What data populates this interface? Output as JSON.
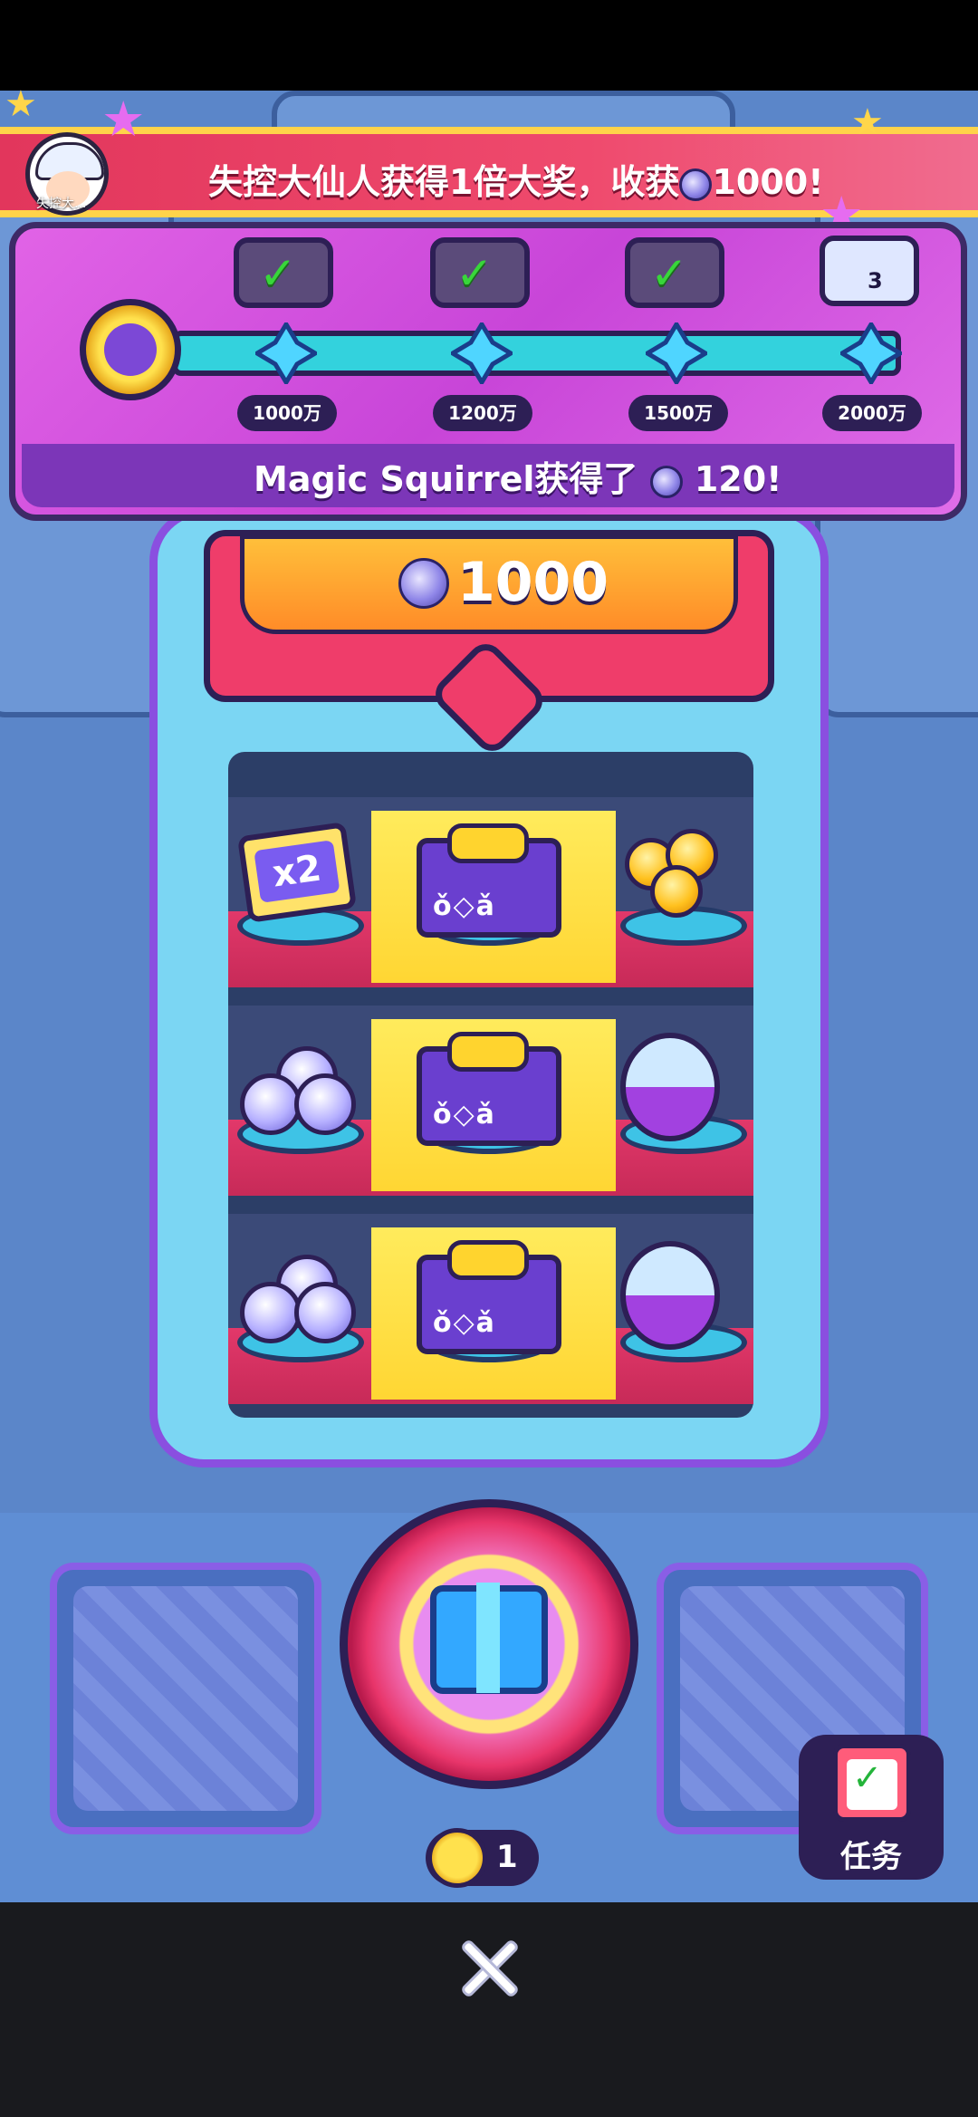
{
  "banner": {
    "avatar_name": "失控大...",
    "text_before": "失控大仙人获得1倍大奖，收获",
    "amount": "1000!"
  },
  "progress": {
    "milestones": [
      {
        "label": "1000万",
        "status": "claimed"
      },
      {
        "label": "1200万",
        "status": "claimed"
      },
      {
        "label": "1500万",
        "status": "claimed"
      },
      {
        "label": "2000万",
        "status": "locked",
        "count": "3"
      }
    ],
    "message_prefix": "Magic Squirrel获得了",
    "message_amount": "120!"
  },
  "jackpot": {
    "value": "1000"
  },
  "shelves": [
    {
      "left": "x2-ticket",
      "center": "prize-sign",
      "right": "gold-balls"
    },
    {
      "left": "gem-cluster",
      "center": "prize-sign",
      "right": "capsule"
    },
    {
      "left": "gem-cluster",
      "center": "prize-sign",
      "right": "capsule"
    }
  ],
  "ticket_label": "x2",
  "prize_symbols": "ǒ◇ǎ",
  "coins": {
    "count": "1"
  },
  "task": {
    "label": "任务"
  },
  "colors": {
    "banner": "#e2365c",
    "panel": "#c845d8",
    "jackpot": "#ef3d6a",
    "track": "#33d2dd"
  }
}
